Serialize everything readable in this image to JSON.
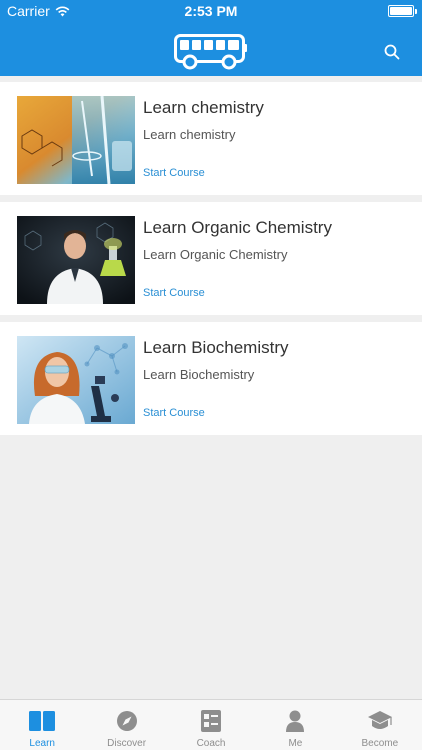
{
  "status_bar": {
    "carrier": "Carrier",
    "time": "2:53 PM"
  },
  "header": {
    "logo_icon": "bus-icon",
    "search_icon": "search-icon",
    "brand_color": "#1d8fe0"
  },
  "courses": [
    {
      "title": "Learn chemistry",
      "subtitle": "Learn chemistry",
      "action": "Start Course",
      "image": "chemistry-lab-image"
    },
    {
      "title": "Learn Organic Chemistry",
      "subtitle": "Learn Organic Chemistry",
      "action": "Start Course",
      "image": "scientist-flask-image"
    },
    {
      "title": "Learn Biochemistry",
      "subtitle": "Learn Biochemistry",
      "action": "Start Course",
      "image": "scientist-microscope-image"
    }
  ],
  "tabs": [
    {
      "label": "Learn",
      "icon": "book-icon",
      "active": true
    },
    {
      "label": "Discover",
      "icon": "compass-icon",
      "active": false
    },
    {
      "label": "Coach",
      "icon": "checklist-icon",
      "active": false
    },
    {
      "label": "Me",
      "icon": "person-icon",
      "active": false
    },
    {
      "label": "Become",
      "icon": "graduation-cap-icon",
      "active": false
    }
  ]
}
